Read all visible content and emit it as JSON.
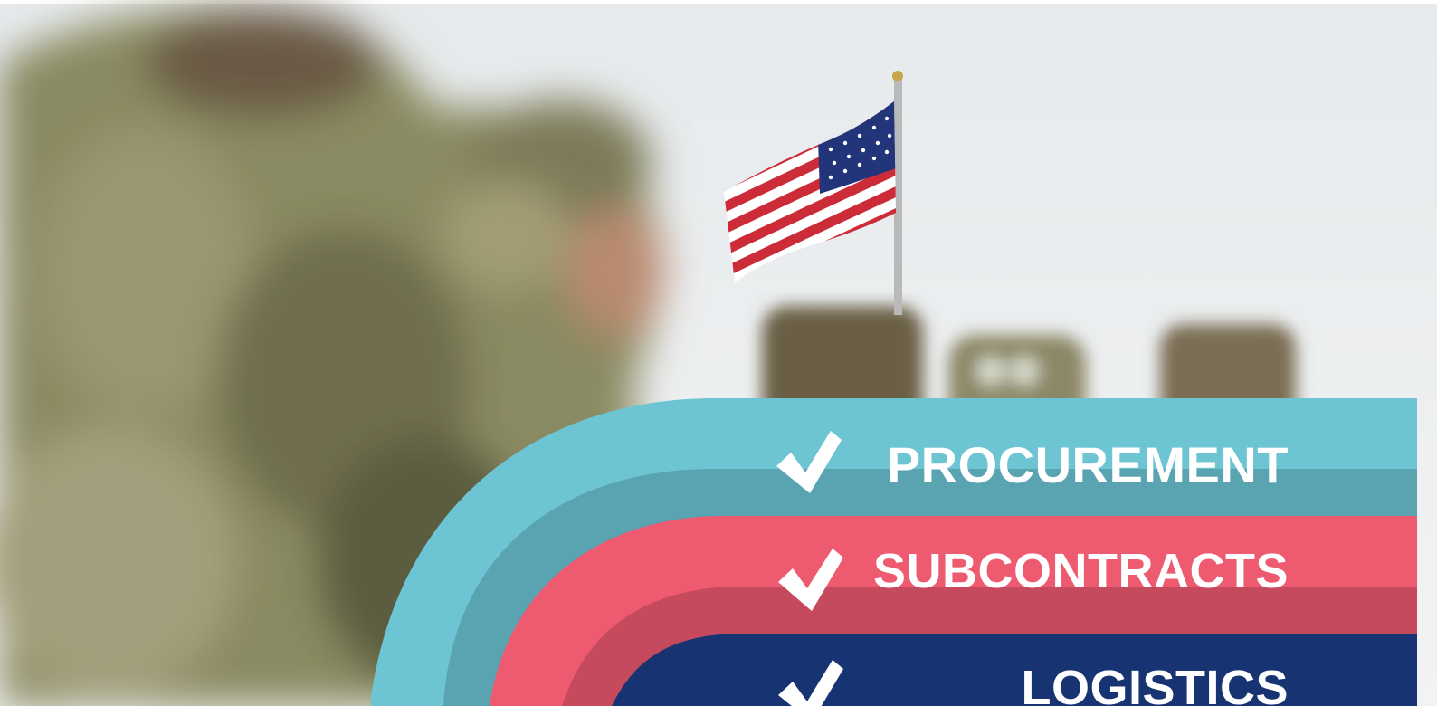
{
  "banner": {
    "items": [
      {
        "label": "PROCUREMENT",
        "icon": "checkmark-icon"
      },
      {
        "label": "SUBCONTRACTS",
        "icon": "checkmark-icon"
      },
      {
        "label": "LOGISTICS",
        "icon": "checkmark-icon"
      }
    ]
  },
  "colors": {
    "sky": "#e9ecef",
    "teal_band": "#6dc4d2",
    "teal_band_dark": "#5aa3b1",
    "pink_band": "#ee5a70",
    "pink_band_dark": "#c64a5e",
    "navy_band": "#173372",
    "text": "#ffffff"
  }
}
